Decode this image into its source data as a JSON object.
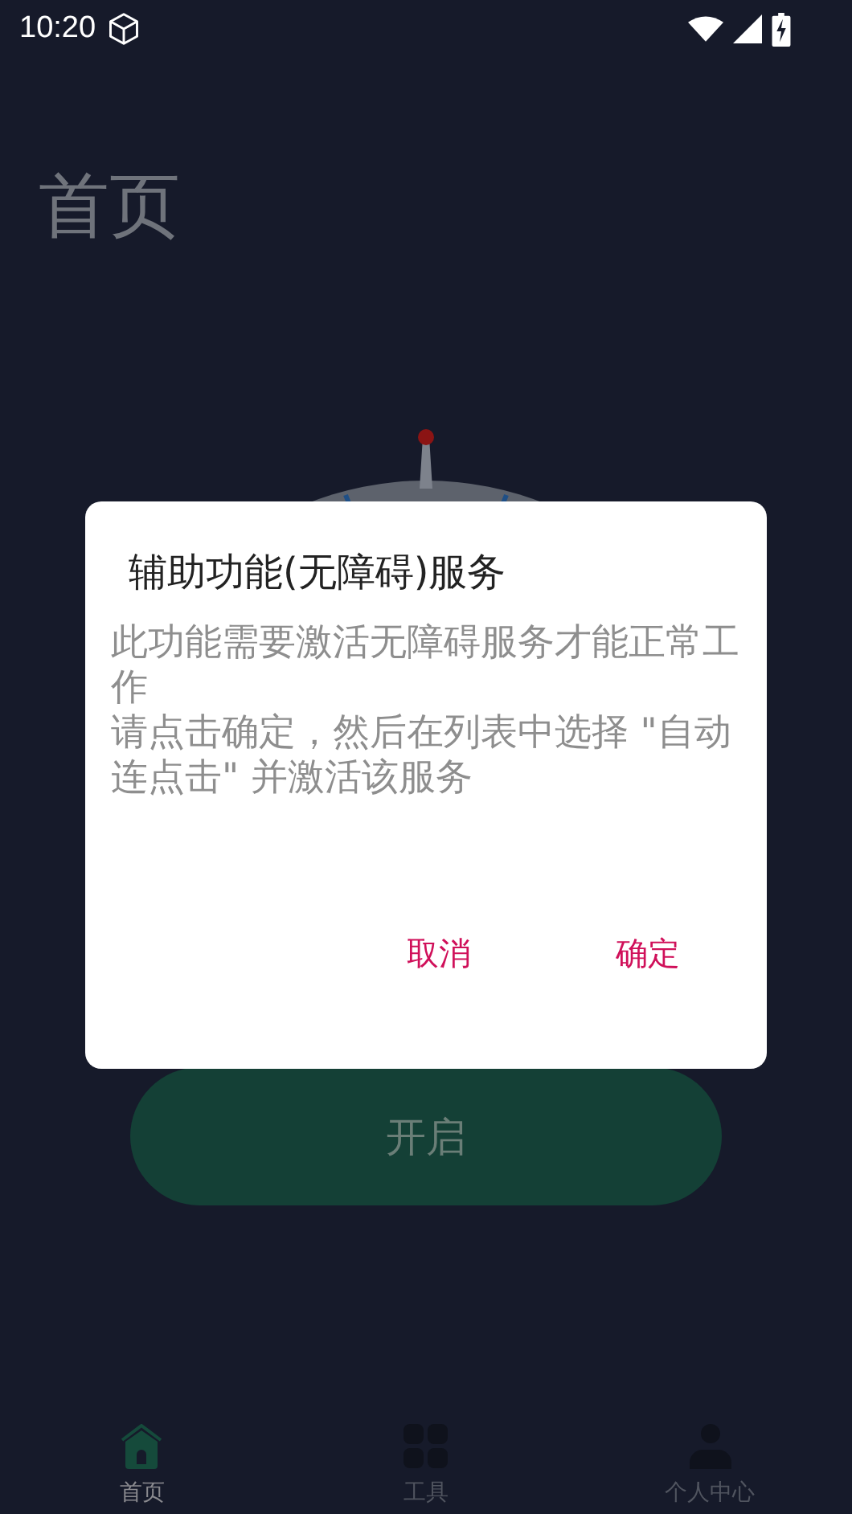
{
  "status_bar": {
    "time": "10:20"
  },
  "page": {
    "title": "首页",
    "start_button": "开启"
  },
  "dialog": {
    "title": "辅助功能(无障碍)服务",
    "message_lines": [
      "此功能需要激活无障碍服务才能正常工作",
      "请点击确定，然后在列表中选择 \"自动连点击\" 并激活该服务"
    ],
    "buttons": [
      "取消",
      "确定"
    ]
  },
  "tabs": [
    {
      "label": "首页",
      "kind": "home",
      "selected": true
    },
    {
      "label": "工具",
      "kind": "grid",
      "selected": false
    },
    {
      "label": "个人中心",
      "kind": "person",
      "selected": false
    }
  ]
}
